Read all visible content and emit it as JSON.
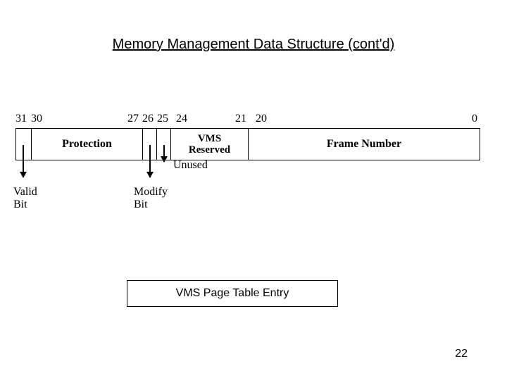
{
  "title": "Memory Management Data Structure (cont'd)",
  "bit_labels": {
    "b31": "31",
    "b30": "30",
    "b27": "27",
    "b26": "26",
    "b25": "25",
    "b24": "24",
    "b21": "21",
    "b20": "20",
    "b0": "0"
  },
  "fields": {
    "valid": "",
    "protection": "Protection",
    "modify": "",
    "unused": "",
    "vms_reserved_l1": "VMS",
    "vms_reserved_l2": "Reserved",
    "frame_number": "Frame Number"
  },
  "annotations": {
    "valid_l1": "Valid",
    "valid_l2": "Bit",
    "modify_l1": "Modify",
    "modify_l2": "Bit",
    "unused": "Unused"
  },
  "caption": "VMS Page Table Entry",
  "page_number": "22",
  "chart_data": {
    "type": "table",
    "title": "VMS Page Table Entry",
    "fields": [
      {
        "name": "Valid Bit",
        "bit_hi": 31,
        "bit_lo": 31
      },
      {
        "name": "Protection",
        "bit_hi": 30,
        "bit_lo": 27
      },
      {
        "name": "Modify Bit",
        "bit_hi": 26,
        "bit_lo": 26
      },
      {
        "name": "Unused",
        "bit_hi": 25,
        "bit_lo": 25
      },
      {
        "name": "VMS Reserved",
        "bit_hi": 24,
        "bit_lo": 21
      },
      {
        "name": "Frame Number",
        "bit_hi": 20,
        "bit_lo": 0
      }
    ]
  }
}
